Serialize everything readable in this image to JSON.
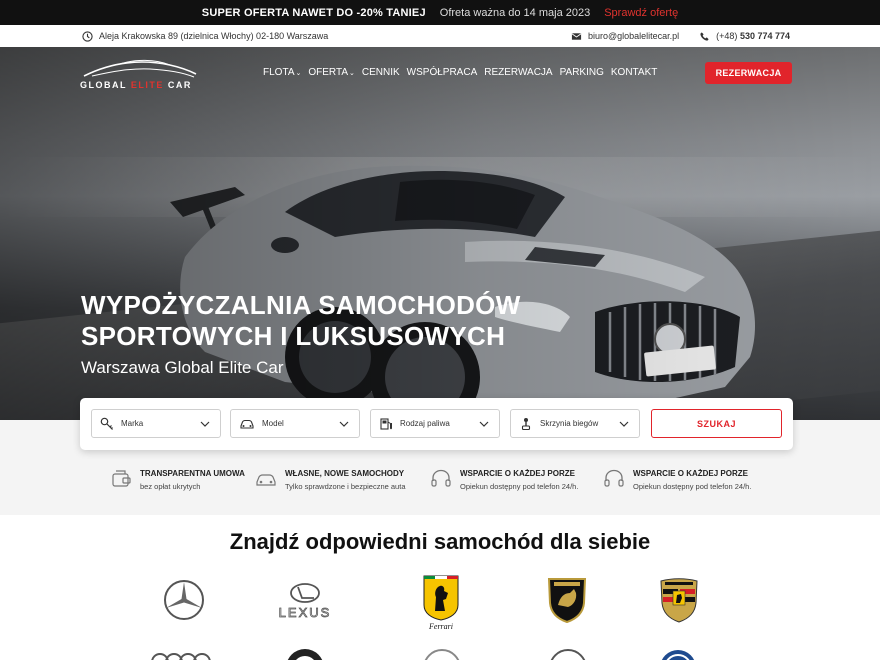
{
  "promo": {
    "title": "SUPER OFERTA NAWET DO -20% TANIEJ",
    "valid": "Ofreta ważna do 14 maja 2023",
    "link": "Sprawdź ofertę"
  },
  "info": {
    "address": "Aleja Krakowska 89 (dzielnica Włochy) 02-180 Warszawa",
    "email": "biuro@globalelitecar.pl",
    "phone_prefix": "(+48)",
    "phone_number": "530 774 774"
  },
  "logo": {
    "part1": "GLOBAL ",
    "part2": "ELITE",
    "part3": " CAR"
  },
  "nav": {
    "items": [
      "FLOTA",
      "OFERTA",
      "CENNIK",
      "WSPÓŁPRACA",
      "REZERWACJA",
      "PARKING",
      "KONTAKT"
    ],
    "reserve_button": "REZERWACJA"
  },
  "hero": {
    "title_line1": "WYPOŻYCZALNIA SAMOCHODÓW",
    "title_line2": "SPORTOWYCH I LUKSUSOWYCH",
    "subtitle": "Warszawa Global Elite Car"
  },
  "search": {
    "brand": "Marka",
    "model": "Model",
    "fuel": "Rodzaj paliwa",
    "gearbox": "Skrzynia biegów",
    "submit": "SZUKAJ"
  },
  "features": [
    {
      "title": "TRANSPARENTNA UMOWA",
      "desc": "bez opłat ukrytych"
    },
    {
      "title": "WŁASNE, NOWE SAMOCHODY",
      "desc": "Tylko sprawdzone i bezpieczne auta"
    },
    {
      "title": "WSPARCIE O KAŻDEJ PORZE",
      "desc": "Opiekun dostępny pod telefon 24/h."
    },
    {
      "title": "WSPARCIE O KAŻDEJ PORZE",
      "desc": "Opiekun dostępny pod telefon 24/h."
    }
  ],
  "brands_section": {
    "title": "Znajdź  odpowiedni samochód dla siebie",
    "brands": [
      "mercedes",
      "lexus",
      "ferrari",
      "lamborghini",
      "porsche"
    ],
    "lexus_label": "LEXUS",
    "ferrari_label": "Ferrari"
  },
  "colors": {
    "accent": "#e1242b",
    "dark": "#111111"
  }
}
